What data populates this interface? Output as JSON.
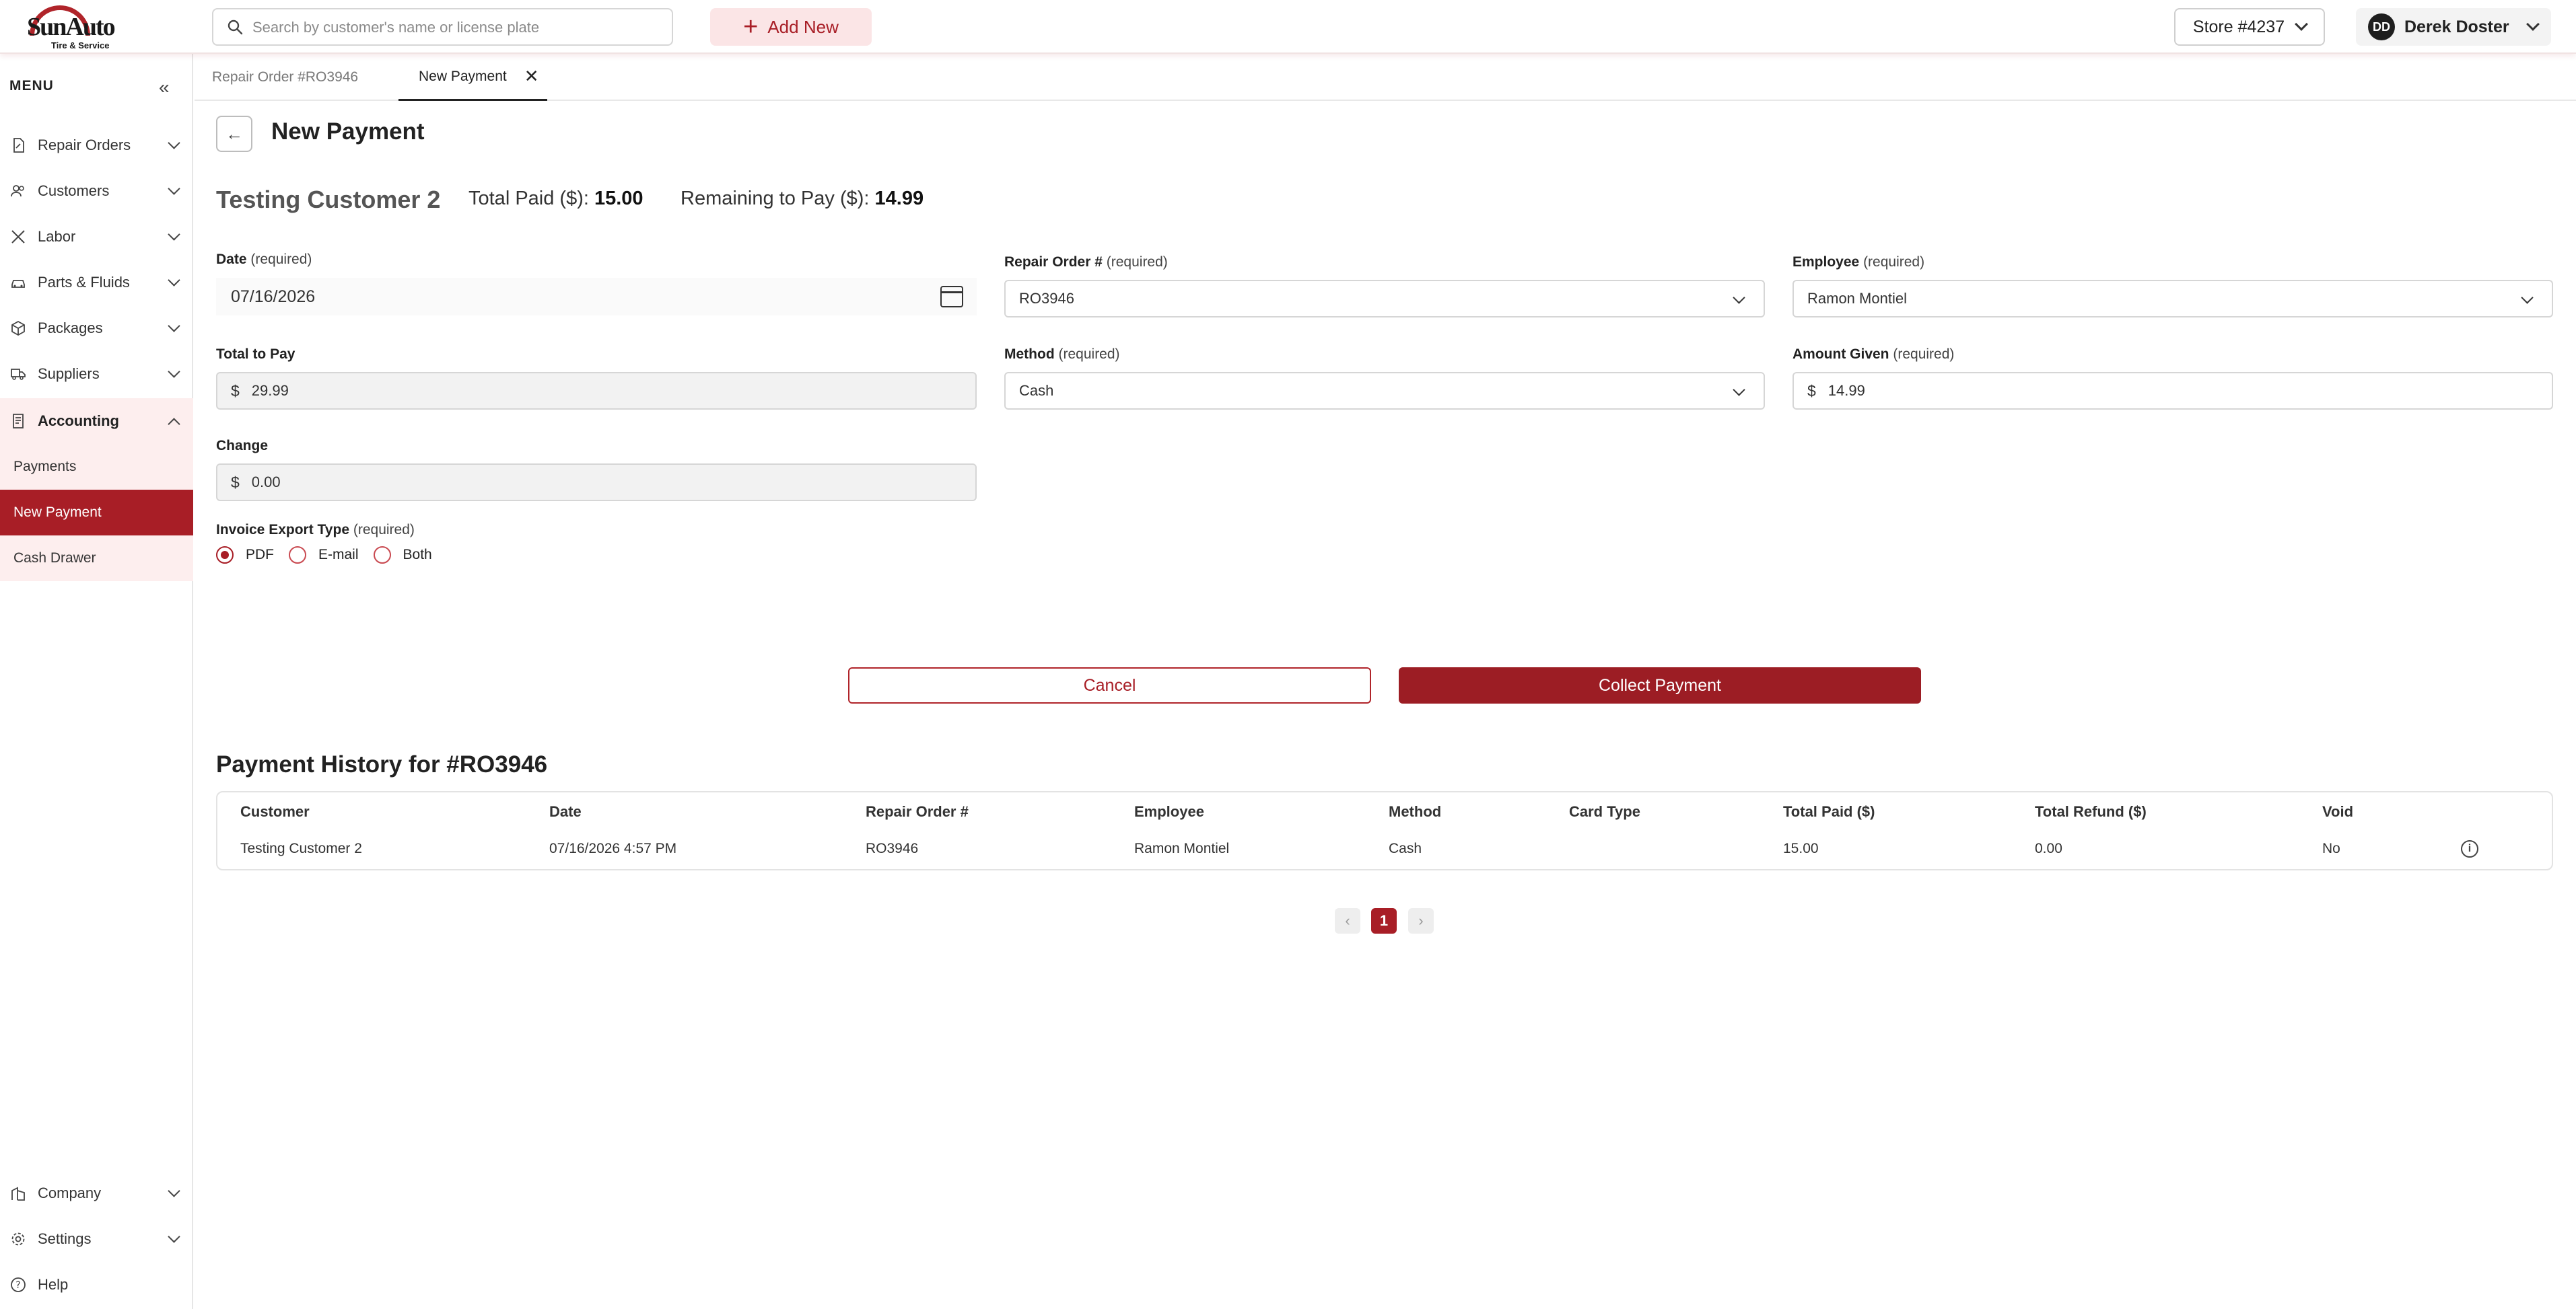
{
  "brand": {
    "name": "SunAuto",
    "tagline": "Tire & Service",
    "accent": "#a81e26"
  },
  "topbar": {
    "search_placeholder": "Search by customer's name or license plate",
    "add_new_label": "Add New",
    "store_label": "Store #4237",
    "user_initials": "DD",
    "user_name": "Derek Doster"
  },
  "sidebar": {
    "menu_label": "MENU",
    "items": [
      {
        "label": "Repair Orders",
        "icon": "document-icon"
      },
      {
        "label": "Customers",
        "icon": "users-icon"
      },
      {
        "label": "Labor",
        "icon": "tools-icon"
      },
      {
        "label": "Parts & Fluids",
        "icon": "car-icon"
      },
      {
        "label": "Packages",
        "icon": "box-icon"
      },
      {
        "label": "Suppliers",
        "icon": "truck-icon"
      },
      {
        "label": "Accounting",
        "icon": "invoice-icon"
      }
    ],
    "accounting_sub": [
      "Payments",
      "New Payment",
      "Cash Drawer"
    ],
    "bottom": [
      {
        "label": "Company",
        "icon": "building-icon"
      },
      {
        "label": "Settings",
        "icon": "gear-icon"
      },
      {
        "label": "Help",
        "icon": "help-icon"
      }
    ]
  },
  "tabs": [
    {
      "label": "Repair Order #RO3946"
    },
    {
      "label": "New Payment"
    }
  ],
  "page": {
    "title": "New Payment",
    "customer_name": "Testing Customer 2",
    "total_paid_label": "Total Paid ($):",
    "total_paid_value": "15.00",
    "remaining_label": "Remaining to Pay ($):",
    "remaining_value": "14.99"
  },
  "form": {
    "required_text": "(required)",
    "date_label": "Date",
    "date_value": "07/16/2026",
    "repair_order_label": "Repair Order #",
    "repair_order_value": "RO3946",
    "employee_label": "Employee",
    "employee_value": "Ramon Montiel",
    "total_to_pay_label": "Total to Pay",
    "total_to_pay_value": "29.99",
    "method_label": "Method",
    "method_value": "Cash",
    "amount_given_label": "Amount Given",
    "amount_given_value": "14.99",
    "change_label": "Change",
    "change_value": "0.00",
    "currency_symbol": "$",
    "export_label": "Invoice Export Type",
    "export_options": [
      "PDF",
      "E-mail",
      "Both"
    ],
    "export_selected": "PDF",
    "cancel_label": "Cancel",
    "collect_label": "Collect Payment"
  },
  "history": {
    "title": "Payment History for #RO3946",
    "columns": [
      "Customer",
      "Date",
      "Repair Order #",
      "Employee",
      "Method",
      "Card Type",
      "Total Paid ($)",
      "Total Refund ($)",
      "Void"
    ],
    "rows": [
      [
        "Testing Customer 2",
        "07/16/2026 4:57 PM",
        "RO3946",
        "Ramon Montiel",
        "Cash",
        "",
        "15.00",
        "0.00",
        "No"
      ]
    ]
  },
  "pagination": {
    "current_page": "1",
    "prev_symbol": "‹",
    "next_symbol": "›"
  }
}
